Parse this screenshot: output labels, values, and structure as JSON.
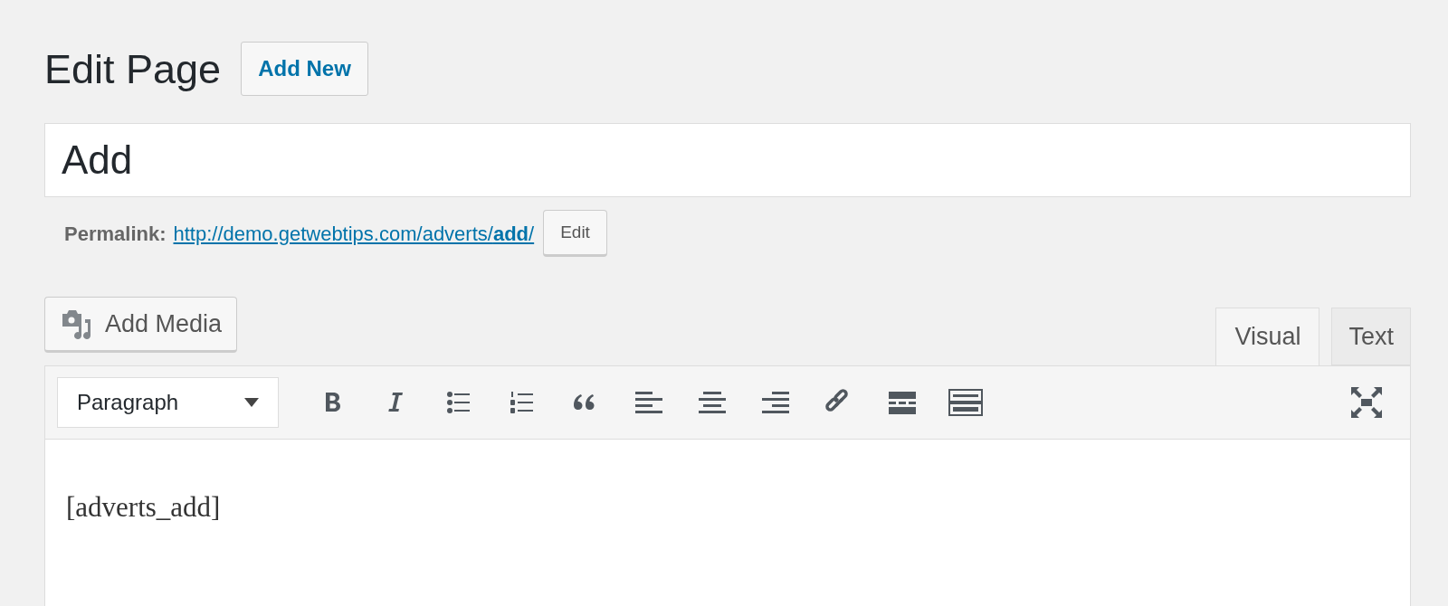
{
  "heading": {
    "title": "Edit Page",
    "add_new": "Add New"
  },
  "title_field": {
    "value": "Add"
  },
  "permalink": {
    "label": "Permalink:",
    "url": "http://demo.getwebtips.com/adverts/**add**/",
    "edit": "Edit"
  },
  "add_media": "Add Media",
  "tabs": [
    {
      "label": "Visual",
      "selected": true
    },
    {
      "label": "Text",
      "selected": false
    }
  ],
  "toolbar": {
    "format": "Paragraph",
    "buttons": [
      {
        "kind": "bold"
      },
      {
        "kind": "italic"
      },
      {
        "kind": "bullets"
      },
      {
        "kind": "numbers"
      },
      {
        "kind": "quote"
      },
      {
        "kind": "align-left"
      },
      {
        "kind": "align-center"
      },
      {
        "kind": "align-right"
      },
      {
        "kind": "link"
      },
      {
        "kind": "more"
      },
      {
        "kind": "toolbar-toggle"
      }
    ]
  },
  "content": "[adverts_add]"
}
